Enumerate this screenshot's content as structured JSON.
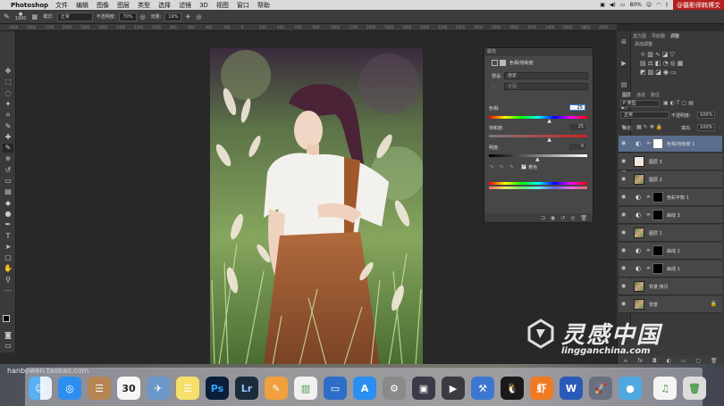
{
  "menubar": {
    "app": "Photoshop",
    "items": [
      "文件",
      "编辑",
      "图像",
      "图层",
      "类型",
      "选择",
      "滤镜",
      "3D",
      "视图",
      "窗口",
      "帮助"
    ],
    "battery": "80%",
    "brand": "@摄影师韩博文"
  },
  "options": {
    "brush_size": "1900",
    "mode_label": "模式:",
    "mode_value": "正常",
    "opacity_label": "不透明度:",
    "opacity_value": "70%",
    "flow_label": "流量:",
    "flow_value": "19%"
  },
  "ruler": [
    "2600",
    "2400",
    "2200",
    "2000",
    "1800",
    "1600",
    "1400",
    "1200",
    "1000",
    "800",
    "600",
    "400",
    "200",
    "0",
    "200",
    "400",
    "600",
    "800",
    "1000",
    "1200",
    "1400",
    "1600",
    "1800",
    "2000",
    "2200",
    "2400",
    "2600",
    "2800",
    "3000",
    "3200",
    "3400",
    "3600",
    "3800",
    "4000"
  ],
  "properties": {
    "tab": "属性",
    "title": "色相/饱和度",
    "preset_label": "预设:",
    "preset_value": "自定",
    "channel_value": "全图",
    "hue_label": "色相:",
    "hue_value": "25",
    "saturation_label": "饱和度:",
    "saturation_value": "25",
    "lightness_label": "明度:",
    "lightness_value": "0",
    "colorize_label": "着色",
    "hue_position": 0.62,
    "saturation_position": 0.62,
    "lightness_position": 0.5
  },
  "right_panels": {
    "top_tabs": [
      "直方图",
      "导航器",
      "调整"
    ],
    "add_adjustment": "添加调整",
    "layers_tabs": [
      "图层",
      "通道",
      "路径"
    ],
    "kind_label": "P 类型",
    "blend_mode": "正常",
    "opacity_label": "不透明度:",
    "opacity_value": "100%",
    "lock_label": "锁定:",
    "fill_label": "填充:",
    "fill_value": "100%",
    "layers": [
      {
        "name": "色相/饱和度 1",
        "type": "adjustment",
        "selected": true
      },
      {
        "name": "图层 3",
        "type": "pixel"
      },
      {
        "name": "图层 2",
        "type": "pixel"
      },
      {
        "name": "色彩平衡 1",
        "type": "adjustment"
      },
      {
        "name": "曲线 3",
        "type": "adjustment"
      },
      {
        "name": "图层 1",
        "type": "pixel"
      },
      {
        "name": "曲线 2",
        "type": "adjustment"
      },
      {
        "name": "曲线 1",
        "type": "adjustment"
      },
      {
        "name": "背景 拷贝",
        "type": "pixel"
      },
      {
        "name": "背景",
        "type": "pixel"
      }
    ]
  },
  "dock": {
    "url": "hanbowen.taobao.com",
    "calendar_day": "30",
    "items": [
      "finder",
      "safari",
      "contacts",
      "calendar",
      "preview",
      "notes",
      "photoshop",
      "lightroom",
      "pages",
      "numbers",
      "keynote",
      "app-store",
      "system-preferences",
      "photo-booth",
      "final-cut",
      "xcode",
      "qq",
      "xiami",
      "word",
      "launchpad",
      "lantern",
      "itunes",
      "trash"
    ]
  },
  "watermark": {
    "title": "灵感中国",
    "domain": "lingganchina.com"
  },
  "colors": {
    "accent_selected": "#5a6d8c",
    "brand_red": "#b51f1f"
  }
}
